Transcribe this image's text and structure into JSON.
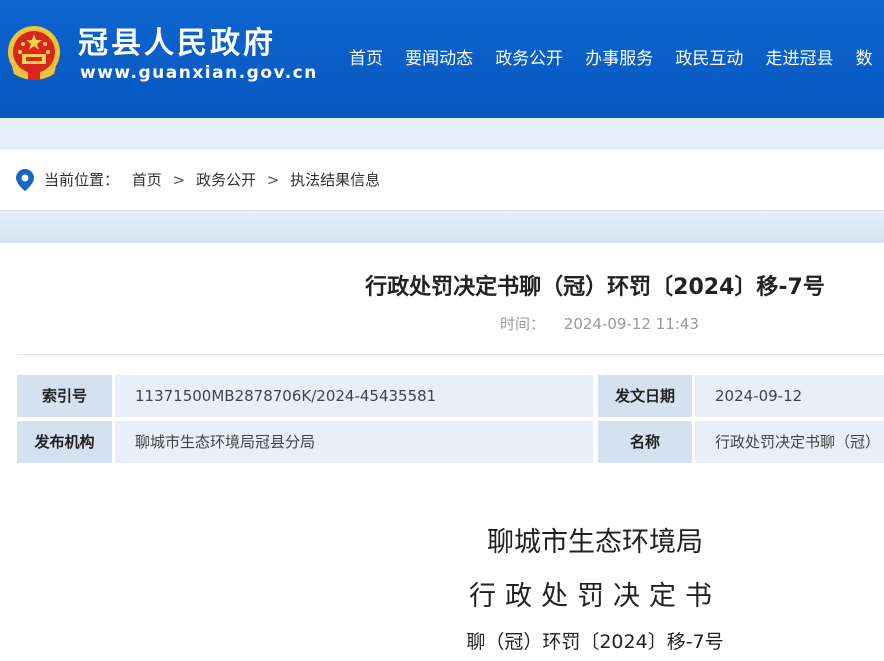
{
  "header": {
    "site_title": "冠县人民政府",
    "site_url": "www.guanxian.gov.cn",
    "emblem_icon": "national-emblem-icon",
    "nav": [
      "首页",
      "要闻动态",
      "政务公开",
      "办事服务",
      "政民互动",
      "走进冠县",
      "数"
    ]
  },
  "breadcrumb": {
    "icon": "location-pin-icon",
    "prefix": "当前位置：",
    "items": [
      "首页",
      "政务公开",
      "执法结果信息"
    ],
    "separator": ">"
  },
  "article": {
    "title": "行政处罚决定书聊（冠）环罚〔2024〕移-7号",
    "time_label": "时间：",
    "time_value": "2024-09-12 11:43"
  },
  "info_table": {
    "index_label": "索引号",
    "index_value": "11371500MB2878706K/2024-45435581",
    "date_label": "发文日期",
    "date_value": "2024-09-12",
    "org_label": "发布机构",
    "org_value": "聊城市生态环境局冠县分局",
    "name_label": "名称",
    "name_value": "行政处罚决定书聊（冠）"
  },
  "document": {
    "line1": "聊城市生态环境局",
    "line2": "行政处罚决定书",
    "line3": "聊（冠）环罚〔2024〕移-7号"
  },
  "colors": {
    "header_blue": "#0a5fc8",
    "band_light": "#e5eef9",
    "table_label_bg": "#d5e1f1",
    "table_value_bg": "#e8eff9",
    "pin_blue": "#1565c8"
  }
}
